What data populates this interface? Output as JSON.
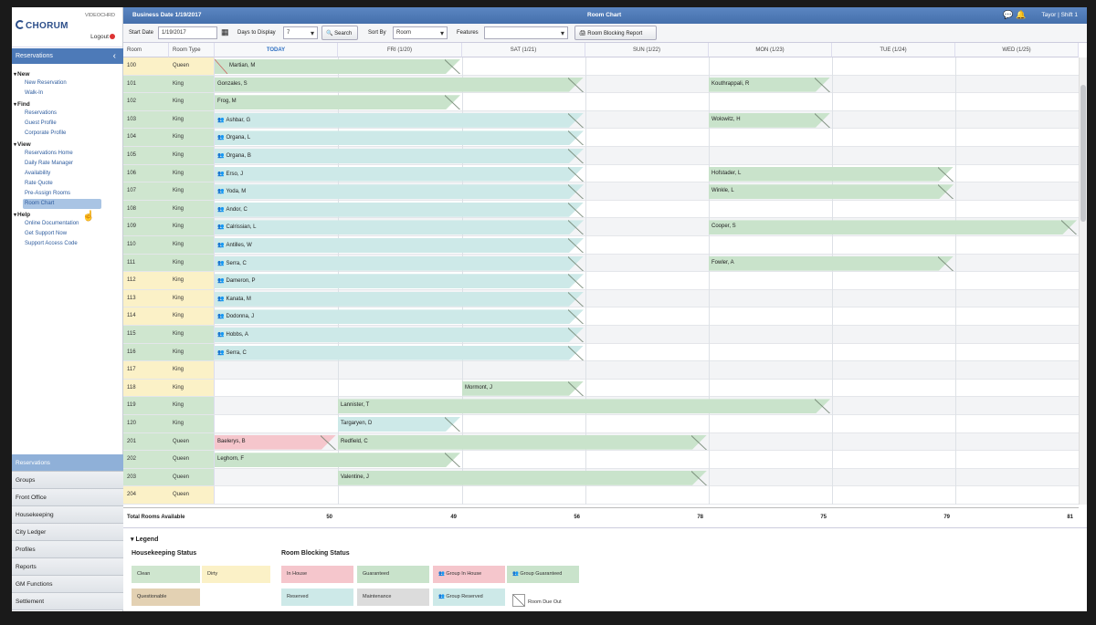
{
  "colors": {
    "clean": "#cfe6cf",
    "dirty": "#fbf1c7",
    "questionable": "#e3d1b3",
    "in_house": "#f5c6cc",
    "guaranteed": "#c9e3cb",
    "group_in_house": "#f5c6cc",
    "group_guaranteed": "#c9e3cb",
    "reserved": "#cde9e8",
    "maintenance": "#dcdcdc",
    "group_reserved": "#cde9e8",
    "accent": "#4d7ab8"
  },
  "sidebar": {
    "logo": "CHORUM",
    "user_tag": "VIDEOCHRD",
    "logout": "Logout",
    "section": "Reservations",
    "groups": [
      {
        "label": "New",
        "items": [
          "New Reservation",
          "Walk-In"
        ]
      },
      {
        "label": "Find",
        "items": [
          "Reservations",
          "Guest Profile",
          "Corporate Profile"
        ]
      },
      {
        "label": "View",
        "items": [
          "Reservations Home",
          "Daily Rate Manager",
          "Availability",
          "Rate Quote",
          "Pre-Assign Rooms",
          "Room Chart"
        ]
      },
      {
        "label": "Help",
        "items": [
          "Online Documentation",
          "Get Support Now",
          "Support Access Code"
        ]
      }
    ],
    "bottom_nav": [
      "Reservations",
      "Groups",
      "Front Office",
      "Housekeeping",
      "City Ledger",
      "Profiles",
      "Reports",
      "GM Functions",
      "Settlement"
    ]
  },
  "topbar": {
    "business_date": "Business Date 1/19/2017",
    "title": "Room Chart",
    "user": "Tayor | Shift 1"
  },
  "toolbar": {
    "start_date_label": "Start Date",
    "start_date": "1/19/2017",
    "days_label": "Days to Display",
    "days": "7",
    "search": "Search",
    "sort_label": "Sort By",
    "sort": "Room",
    "features_label": "Features",
    "features": "",
    "report_button": "Room Blocking Report"
  },
  "grid": {
    "col_room": "Room",
    "col_type": "Room Type",
    "days": [
      "TODAY",
      "FRI (1/20)",
      "SAT (1/21)",
      "SUN (1/22)",
      "MON (1/23)",
      "TUE (1/24)",
      "WED (1/25)"
    ],
    "rooms": [
      {
        "room": "100",
        "type": "Queen",
        "hk": "dirty"
      },
      {
        "room": "101",
        "type": "King",
        "hk": "clean"
      },
      {
        "room": "102",
        "type": "King",
        "hk": "clean"
      },
      {
        "room": "103",
        "type": "King",
        "hk": "clean"
      },
      {
        "room": "104",
        "type": "King",
        "hk": "clean"
      },
      {
        "room": "105",
        "type": "King",
        "hk": "clean"
      },
      {
        "room": "106",
        "type": "King",
        "hk": "clean"
      },
      {
        "room": "107",
        "type": "King",
        "hk": "clean"
      },
      {
        "room": "108",
        "type": "King",
        "hk": "clean"
      },
      {
        "room": "109",
        "type": "King",
        "hk": "clean"
      },
      {
        "room": "110",
        "type": "King",
        "hk": "clean"
      },
      {
        "room": "111",
        "type": "King",
        "hk": "clean"
      },
      {
        "room": "112",
        "type": "King",
        "hk": "dirty"
      },
      {
        "room": "113",
        "type": "King",
        "hk": "dirty"
      },
      {
        "room": "114",
        "type": "King",
        "hk": "dirty"
      },
      {
        "room": "115",
        "type": "King",
        "hk": "clean"
      },
      {
        "room": "116",
        "type": "King",
        "hk": "clean"
      },
      {
        "room": "117",
        "type": "King",
        "hk": "dirty"
      },
      {
        "room": "118",
        "type": "King",
        "hk": "dirty"
      },
      {
        "room": "119",
        "type": "King",
        "hk": "clean"
      },
      {
        "room": "120",
        "type": "King",
        "hk": "clean"
      },
      {
        "room": "201",
        "type": "Queen",
        "hk": "clean"
      },
      {
        "room": "202",
        "type": "Queen",
        "hk": "clean"
      },
      {
        "room": "203",
        "type": "Queen",
        "hk": "clean"
      },
      {
        "room": "204",
        "type": "Queen",
        "hk": "dirty"
      }
    ],
    "blocks": [
      {
        "row": 0,
        "start": 0,
        "end": 2,
        "name": "Martian, M",
        "status": "guaranteed",
        "group": false,
        "due_out": true
      },
      {
        "row": 1,
        "start": 0,
        "end": 3,
        "name": "Gonzales, S",
        "status": "guaranteed",
        "group": false
      },
      {
        "row": 1,
        "start": 4,
        "end": 5,
        "name": "Kouthrappali, R",
        "status": "guaranteed",
        "group": false
      },
      {
        "row": 2,
        "start": 0,
        "end": 2,
        "name": "Frog, M",
        "status": "guaranteed",
        "group": false
      },
      {
        "row": 3,
        "start": 0,
        "end": 3,
        "name": "Ashbar, G",
        "status": "reserved",
        "group": true
      },
      {
        "row": 3,
        "start": 4,
        "end": 5,
        "name": "Wolowitz, H",
        "status": "guaranteed",
        "group": false
      },
      {
        "row": 4,
        "start": 0,
        "end": 3,
        "name": "Organa, L",
        "status": "reserved",
        "group": true
      },
      {
        "row": 5,
        "start": 0,
        "end": 3,
        "name": "Organa, B",
        "status": "reserved",
        "group": true
      },
      {
        "row": 6,
        "start": 0,
        "end": 3,
        "name": "Erso, J",
        "status": "reserved",
        "group": true
      },
      {
        "row": 6,
        "start": 4,
        "end": 6,
        "name": "Hofstader, L",
        "status": "guaranteed",
        "group": false
      },
      {
        "row": 7,
        "start": 0,
        "end": 3,
        "name": "Yoda, M",
        "status": "reserved",
        "group": true
      },
      {
        "row": 7,
        "start": 4,
        "end": 6,
        "name": "Winkle, L",
        "status": "guaranteed",
        "group": false
      },
      {
        "row": 8,
        "start": 0,
        "end": 3,
        "name": "Andor, C",
        "status": "reserved",
        "group": true
      },
      {
        "row": 9,
        "start": 0,
        "end": 3,
        "name": "Calrissian, L",
        "status": "reserved",
        "group": true
      },
      {
        "row": 9,
        "start": 4,
        "end": 7,
        "name": "Cooper, S",
        "status": "guaranteed",
        "group": false
      },
      {
        "row": 10,
        "start": 0,
        "end": 3,
        "name": "Antilles, W",
        "status": "reserved",
        "group": true
      },
      {
        "row": 11,
        "start": 0,
        "end": 3,
        "name": "Serra, C",
        "status": "reserved",
        "group": true
      },
      {
        "row": 11,
        "start": 4,
        "end": 6,
        "name": "Fowler, A",
        "status": "guaranteed",
        "group": false
      },
      {
        "row": 12,
        "start": 0,
        "end": 3,
        "name": "Dameron, P",
        "status": "reserved",
        "group": true
      },
      {
        "row": 13,
        "start": 0,
        "end": 3,
        "name": "Kanata, M",
        "status": "reserved",
        "group": true
      },
      {
        "row": 14,
        "start": 0,
        "end": 3,
        "name": "Dodonna, J",
        "status": "reserved",
        "group": true
      },
      {
        "row": 15,
        "start": 0,
        "end": 3,
        "name": "Hobbs, A",
        "status": "reserved",
        "group": true
      },
      {
        "row": 16,
        "start": 0,
        "end": 3,
        "name": "Serra, C",
        "status": "reserved",
        "group": true
      },
      {
        "row": 18,
        "start": 2,
        "end": 3,
        "name": "Mormont, J",
        "status": "guaranteed",
        "group": false
      },
      {
        "row": 19,
        "start": 1,
        "end": 5,
        "name": "Lannister, T",
        "status": "guaranteed",
        "group": false
      },
      {
        "row": 20,
        "start": 1,
        "end": 2,
        "name": "Targaryen, D",
        "status": "reserved",
        "group": false
      },
      {
        "row": 21,
        "start": 0,
        "end": 1,
        "name": "Baelerys, B",
        "status": "in_house",
        "group": false
      },
      {
        "row": 21,
        "start": 1,
        "end": 4,
        "name": "Redfield, C",
        "status": "guaranteed",
        "group": false
      },
      {
        "row": 22,
        "start": 0,
        "end": 2,
        "name": "Leghorn, F",
        "status": "guaranteed",
        "group": false
      },
      {
        "row": 23,
        "start": 1,
        "end": 4,
        "name": "Valentine, J",
        "status": "guaranteed",
        "group": false
      }
    ],
    "total_label": "Total Rooms Available",
    "totals": [
      "50",
      "49",
      "56",
      "78",
      "75",
      "79",
      "81"
    ]
  },
  "legend": {
    "title": "Legend",
    "housekeeping_title": "Housekeeping Status",
    "housekeeping": [
      "Clean",
      "Dirty",
      "Questionable"
    ],
    "blocking_title": "Room Blocking Status",
    "blocking": [
      "In House",
      "Guaranteed",
      "Group In House",
      "Group Guaranteed",
      "Reserved",
      "Maintenance",
      "Group Reserved",
      "Room Due Out"
    ]
  }
}
